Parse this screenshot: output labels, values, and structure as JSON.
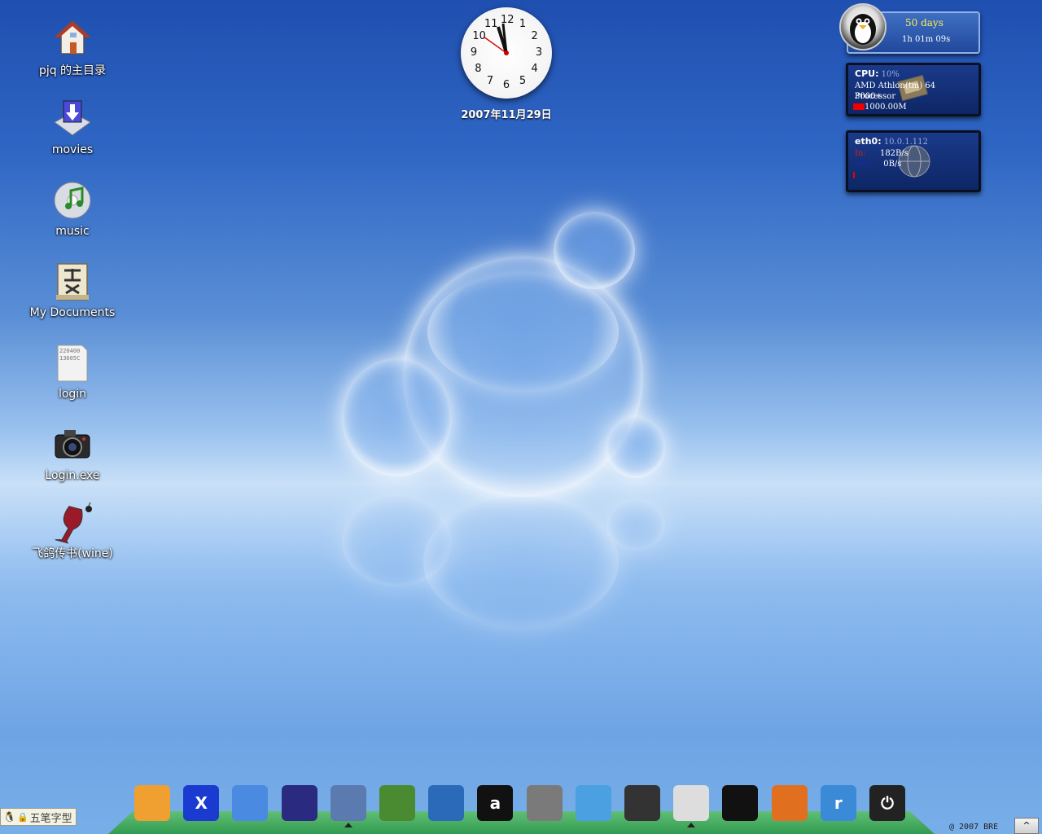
{
  "desktop_icons": [
    {
      "label": "pjq 的主目录",
      "icon": "home-folder-icon"
    },
    {
      "label": "movies",
      "icon": "download-folder-icon"
    },
    {
      "label": "music",
      "icon": "music-cd-icon"
    },
    {
      "label": "My Documents",
      "icon": "documents-scroll-icon"
    },
    {
      "label": "login",
      "icon": "text-file-icon",
      "preview": "220400\n13605C"
    },
    {
      "label": "Login.exe",
      "icon": "camera-icon"
    },
    {
      "label": "飞鸽传书(wine)",
      "icon": "wine-glass-icon"
    }
  ],
  "clock": {
    "numbers": [
      "12",
      "1",
      "2",
      "3",
      "4",
      "5",
      "6",
      "7",
      "8",
      "9",
      "10",
      "11"
    ]
  },
  "date": "2007年11月29日",
  "uptime": {
    "days": "50 days",
    "time": "1h 01m 09s"
  },
  "cpu": {
    "label": "CPU:",
    "percent": "10%",
    "model": "AMD Athlon(tm) 64 Processor",
    "model2": "3000+",
    "freq": "1000.00M"
  },
  "net": {
    "label": "eth0:",
    "ip": "10.0.1.112",
    "in_label": "In:",
    "in_rate": "182B/s",
    "out_label": "Out:",
    "out_rate": "0B/s"
  },
  "dock": [
    {
      "name": "kde-paint-icon",
      "glyph": "",
      "color": "#f0a030"
    },
    {
      "name": "x-app-icon",
      "glyph": "X",
      "color": "#1a3ad0"
    },
    {
      "name": "aim-messenger-icon",
      "glyph": "",
      "color": "#4a8ae0"
    },
    {
      "name": "eclipse-icon",
      "glyph": "",
      "color": "#2a2a80"
    },
    {
      "name": "puzzle-app-icon",
      "glyph": "",
      "color": "#5a7ab0"
    },
    {
      "name": "books-icon",
      "glyph": "",
      "color": "#4a8a30"
    },
    {
      "name": "system-monitor-icon",
      "glyph": "",
      "color": "#2a6ab8"
    },
    {
      "name": "amarok-icon",
      "glyph": "a",
      "color": "#111111"
    },
    {
      "name": "multimedia-icon",
      "glyph": "",
      "color": "#7a7a7a"
    },
    {
      "name": "network-share-icon",
      "glyph": "",
      "color": "#4aa0e0"
    },
    {
      "name": "camera-app-icon",
      "glyph": "",
      "color": "#333333"
    },
    {
      "name": "screen-penguin-icon",
      "glyph": "",
      "color": "#dddddd"
    },
    {
      "name": "qq-penguin-icon",
      "glyph": "",
      "color": "#111111"
    },
    {
      "name": "firefox-icon",
      "glyph": "",
      "color": "#e07020"
    },
    {
      "name": "realplayer-icon",
      "glyph": "r",
      "color": "#3a8ad8"
    },
    {
      "name": "power-icon",
      "glyph": "⏻",
      "color": "#222222"
    }
  ],
  "tray": {
    "ime_label": "五笔字型",
    "copyright": "@ 2007 BRE",
    "show_btn": "^"
  }
}
